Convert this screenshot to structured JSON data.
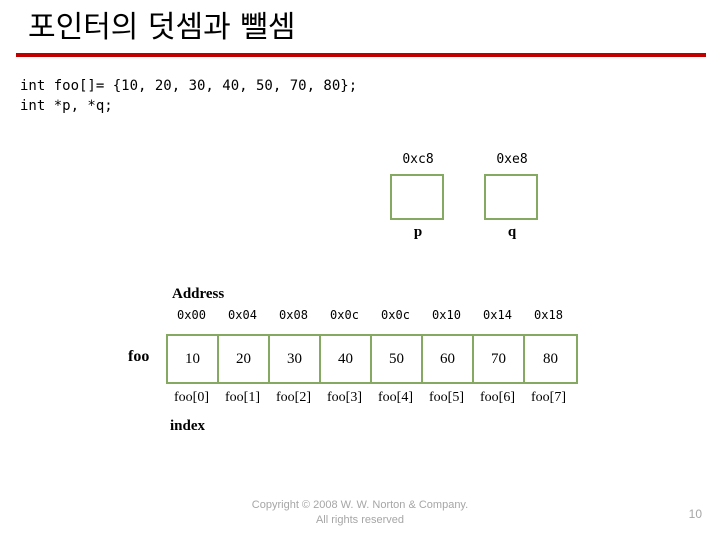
{
  "slide": {
    "title": "포인터의 덧셈과 뺄셈",
    "rule_color": "#c00000",
    "page_number": "10"
  },
  "code": {
    "line1": "int foo[]= {10, 20, 30, 40, 50, 70, 80};",
    "line2": "int *p, *q;"
  },
  "pointers": [
    {
      "address": "0xc8",
      "name": "p",
      "value": ""
    },
    {
      "address": "0xe8",
      "name": "q",
      "value": ""
    }
  ],
  "array": {
    "address_heading": "Address",
    "variable_label": "foo",
    "index_label": "index",
    "border_color": "#86a961",
    "addresses": [
      "0x00",
      "0x04",
      "0x08",
      "0x0c",
      "0x0c",
      "0x10",
      "0x14",
      "0x18"
    ],
    "values": [
      "10",
      "20",
      "30",
      "40",
      "50",
      "60",
      "70",
      "80"
    ],
    "indices": [
      "foo[0]",
      "foo[1]",
      "foo[2]",
      "foo[3]",
      "foo[4]",
      "foo[5]",
      "foo[6]",
      "foo[7]"
    ]
  },
  "footer": {
    "line1": "Copyright © 2008 W. W. Norton & Company.",
    "line2": "All rights reserved"
  }
}
